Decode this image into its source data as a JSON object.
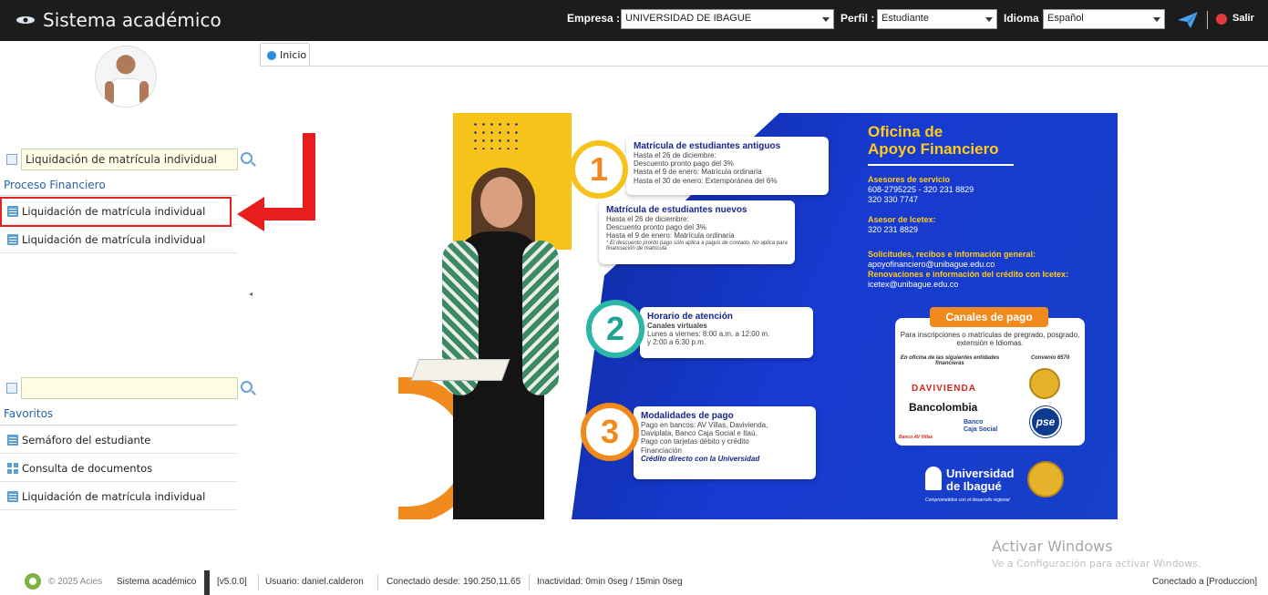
{
  "header": {
    "app_title": "Sistema académico",
    "company_label": "Empresa :",
    "company_value": "UNIVERSIDAD DE IBAGUE",
    "profile_label": "Perfil :",
    "profile_value": "Estudiante",
    "language_label": "Idioma :",
    "language_value": "Español",
    "exit_label": "Salir"
  },
  "sidebar": {
    "search_value": "Liquidación de matrícula individual",
    "section_title": "Proceso Financiero",
    "results": [
      {
        "label": "Liquidación de matrícula individual"
      },
      {
        "label": "Liquidación de matrícula individual"
      }
    ],
    "favorites_search_value": "",
    "favorites_title": "Favoritos",
    "favorites": [
      {
        "label": "Semáforo del estudiante",
        "icon": "list-icon"
      },
      {
        "label": "Consulta de documentos",
        "icon": "grid-icon"
      },
      {
        "label": "Liquidación de matrícula individual",
        "icon": "list-icon"
      }
    ]
  },
  "tabs": [
    {
      "label": "Inicio"
    }
  ],
  "banner": {
    "step1": {
      "number": "1",
      "title": "Matrícula de estudiantes antiguos",
      "lines": [
        "Hasta el 26 de diciembre:",
        "Descuento pronto pago del 3%",
        "Hasta el 9 de enero: Matrícula ordinaria",
        "Hasta el 30 de enero: Extemporánea del 6%"
      ],
      "title2": "Matrícula de estudiantes nuevos",
      "lines2": [
        "Hasta el 26 de diciembre:",
        "Descuento pronto pago del 3%",
        "Hasta el 9 de enero: Matrícula ordinaria"
      ],
      "note": "* El descuento pronto pago sólo aplica a pagos de contado. No aplica para financiación de matrícula."
    },
    "step2": {
      "number": "2",
      "title": "Horario de atención",
      "subtitle": "Canales virtuales",
      "lines": [
        "Lunes a viernes: 8:00 a.m. a 12:00 m.",
        "y 2:00 a 6:30 p.m."
      ]
    },
    "step3": {
      "number": "3",
      "title": "Modalidades de pago",
      "lines": [
        "Pago en bancos: AV Villas, Davivienda,",
        "Daviplata, Banco Caja Social e Itaú.",
        "Pago con tarjetas débito y crédito",
        "Financiación"
      ],
      "emphasis": "Crédito directo con la Universidad"
    },
    "office": {
      "title_line1": "Oficina de",
      "title_line2": "Apoyo Financiero",
      "advisors_label": "Asesores de servicio",
      "advisors_phone1": "608-2795225 - 320 231 8829",
      "advisors_phone2": "320 330 7747",
      "icetex_label": "Asesor de Icetex:",
      "icetex_phone": "320 231 8829",
      "requests_label": "Solicitudes, recibos e información general:",
      "requests_email": "apoyofinanciero@unibague.edu.co",
      "renewals_label": "Renovaciones e información del crédito con Icetex:",
      "renewals_email": "icetex@unibague.edu.co"
    },
    "payment": {
      "title": "Canales de pago",
      "desc": "Para inscripciones o matrículas de pregrado, posgrado, extensión e Idiomas.",
      "left_label": "En oficina de las siguientes entidades financieras",
      "right_label": "Convenio 6570",
      "bank1": "DAVIVIENDA",
      "bank2": "Bancolombia",
      "bank3": "Banco AV Villas",
      "bank4_line1": "Banco",
      "bank4_line2": "Caja Social",
      "pse": "pse"
    },
    "university": {
      "name_line1": "Universidad",
      "name_line2": "de Ibagué",
      "tagline": "Comprometidos con el desarrollo regional"
    }
  },
  "watermark": {
    "line1": "Activar Windows",
    "line2": "Ve a Configuración para activar Windows."
  },
  "footer": {
    "copyright": "© 2025 Acies",
    "system": "Sistema académico",
    "version": "[v5.0.0]",
    "user": "Usuario: daniel.calderon",
    "connected_from": "Conectado desde: 190.250.11.65",
    "inactivity": "Inactividad: 0min 0seg / 15min 0seg",
    "env": "Conectado a [Produccion]"
  }
}
